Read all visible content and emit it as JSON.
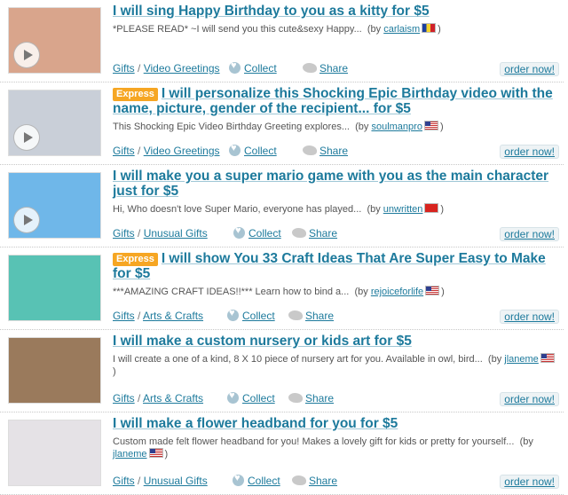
{
  "gigs": [
    {
      "express": "",
      "title": "I will sing Happy Birthday to you as a kitty for $5",
      "desc": "*PLEASE READ* ~I will send you this cute&sexy Happy...",
      "by": "(by",
      "user": "carlaism",
      "flag": "ro",
      "close": ")",
      "cat1": "Gifts",
      "cat2": "Video Greetings",
      "collect": "Collect",
      "share": "Share",
      "order": "order now!",
      "thumb_color": "#d9a58c"
    },
    {
      "express": "Express",
      "title": "I will personalize this Shocking Epic Birthday video with the name, picture, gender of the recipient... for $5",
      "desc": "This Shocking Epic Video Birthday Greeting explores...",
      "by": "(by",
      "user": "soulmanpro",
      "flag": "us",
      "close": ")",
      "cat1": "Gifts",
      "cat2": "Video Greetings",
      "collect": "Collect",
      "share": "Share",
      "order": "order now!",
      "thumb_color": "#c9cfd8"
    },
    {
      "express": "",
      "title": "I will make you a super mario game with you as the main character just for $5",
      "desc": "Hi, Who doesn't love Super Mario, everyone has played...",
      "by": "(by",
      "user": "unwritten",
      "flag": "cn",
      "close": ")",
      "cat1": "Gifts",
      "cat2": "Unusual Gifts",
      "collect": "Collect",
      "share": "Share",
      "order": "order now!",
      "thumb_color": "#6fb7e9"
    },
    {
      "express": "Express",
      "title": "I will show You 33 Craft Ideas That Are Super Easy to Make for $5",
      "desc": "***AMAZING CRAFT IDEAS!!*** Learn how to bind a...",
      "by": "(by",
      "user": "rejoiceforlife",
      "flag": "us",
      "close": ")",
      "cat1": "Gifts",
      "cat2": "Arts & Crafts",
      "collect": "Collect",
      "share": "Share",
      "order": "order now!",
      "thumb_color": "#58c2b4"
    },
    {
      "express": "",
      "title": "I will make a custom nursery or kids art for $5",
      "desc": "I will create a one of a kind, 8 X 10 piece of nursery art for you. Available in owl, bird...",
      "by": "(by",
      "user": "jlaneme",
      "flag": "us",
      "close": ")",
      "cat1": "Gifts",
      "cat2": "Arts & Crafts",
      "collect": "Collect",
      "share": "Share",
      "order": "order now!",
      "thumb_color": "#9a7a5c"
    },
    {
      "express": "",
      "title": "I will make a flower headband for you for $5",
      "desc": "Custom made felt flower headband for you! Makes a lovely gift for kids or pretty for yourself...",
      "by": "(by",
      "user": "jlaneme",
      "flag": "us",
      "close": ")",
      "cat1": "Gifts",
      "cat2": "Unusual Gifts",
      "collect": "Collect",
      "share": "Share",
      "order": "order now!",
      "thumb_color": "#e5e2e6"
    }
  ]
}
